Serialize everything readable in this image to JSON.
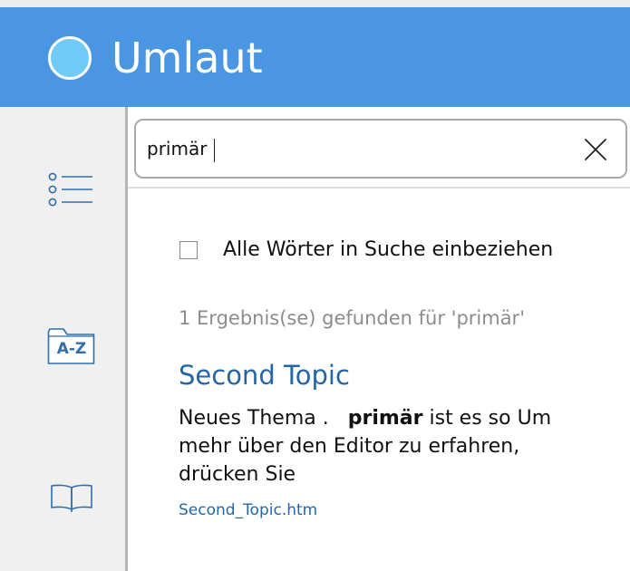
{
  "header": {
    "title": "Umlaut"
  },
  "sidebar": {
    "items": [
      {
        "name": "contents",
        "icon": "list-icon"
      },
      {
        "name": "index",
        "icon": "a-z-folder-icon",
        "icon_text": "A-Z"
      },
      {
        "name": "glossary",
        "icon": "open-book-icon"
      }
    ]
  },
  "search": {
    "value": "primär",
    "clear_icon": "close-icon"
  },
  "options": {
    "include_all_words_label": "Alle Wörter in Suche einbeziehen",
    "include_all_words_checked": false
  },
  "results": {
    "count_text": "1 Ergebnis(se) gefunden für 'primär'",
    "items": [
      {
        "title": "Second Topic",
        "snippet_before": "Neues Thema .   ",
        "snippet_match": "primär",
        "snippet_after": " ist es so Um mehr über den Editor zu erfahren, drücken Sie",
        "url": "Second_Topic.htm"
      }
    ]
  },
  "colors": {
    "header_bg": "#4a96e2",
    "link": "#2566a8",
    "logo": "#6fcaf6",
    "sidebar_bg": "#f0f0f0"
  }
}
